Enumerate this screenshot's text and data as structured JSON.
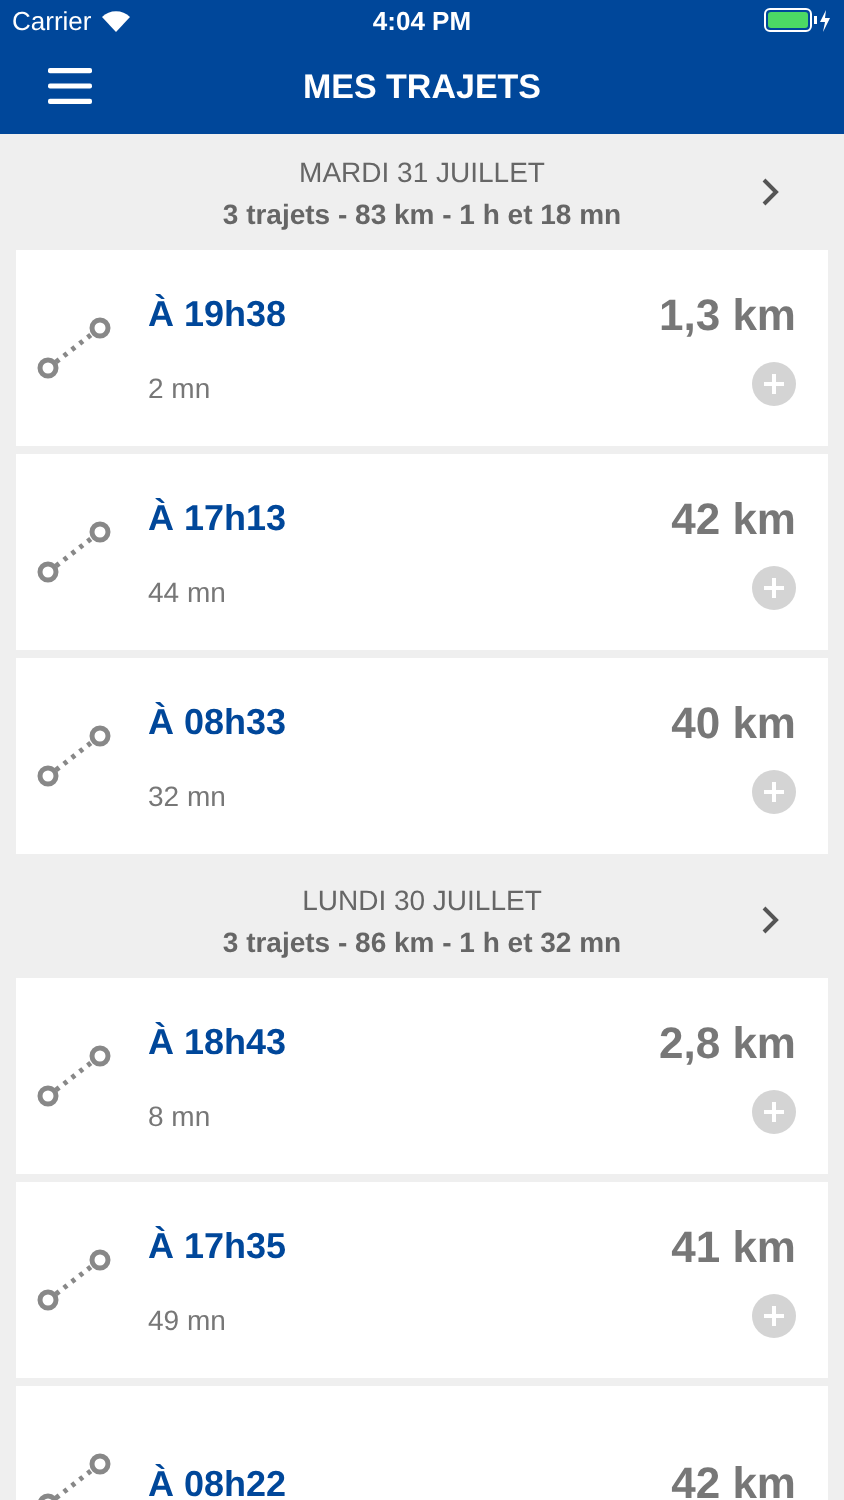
{
  "status_bar": {
    "carrier": "Carrier",
    "time": "4:04 PM"
  },
  "nav": {
    "title": "MES TRAJETS"
  },
  "days": [
    {
      "date": "MARDI 31 JUILLET",
      "summary": "3 trajets - 83 km - 1 h et 18 mn",
      "trips": [
        {
          "time": "À 19h38",
          "duration": "2 mn",
          "distance": "1,3 km"
        },
        {
          "time": "À 17h13",
          "duration": "44 mn",
          "distance": "42 km"
        },
        {
          "time": "À 08h33",
          "duration": "32 mn",
          "distance": "40 km"
        }
      ]
    },
    {
      "date": "LUNDI 30 JUILLET",
      "summary": "3 trajets - 86 km - 1 h et 32 mn",
      "trips": [
        {
          "time": "À 18h43",
          "duration": "8 mn",
          "distance": "2,8 km"
        },
        {
          "time": "À 17h35",
          "duration": "49 mn",
          "distance": "41 km"
        },
        {
          "time": "À 08h22",
          "distance": "42 km",
          "add_button": false
        }
      ]
    }
  ]
}
